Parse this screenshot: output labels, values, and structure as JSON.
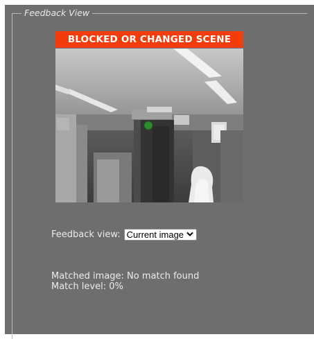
{
  "fieldset": {
    "legend": "Feedback View"
  },
  "banner": {
    "text": "BLOCKED OR CHANGED SCENE",
    "color": "#f23c0a"
  },
  "feed": {
    "marker_color": "#2e8b2e"
  },
  "feedback_view": {
    "label": "Feedback view:",
    "selected": "Current image",
    "chevron_icon": "chevron-down-icon"
  },
  "match": {
    "matched_image": "Matched image: No match found",
    "match_level": "Match level: 0%"
  }
}
